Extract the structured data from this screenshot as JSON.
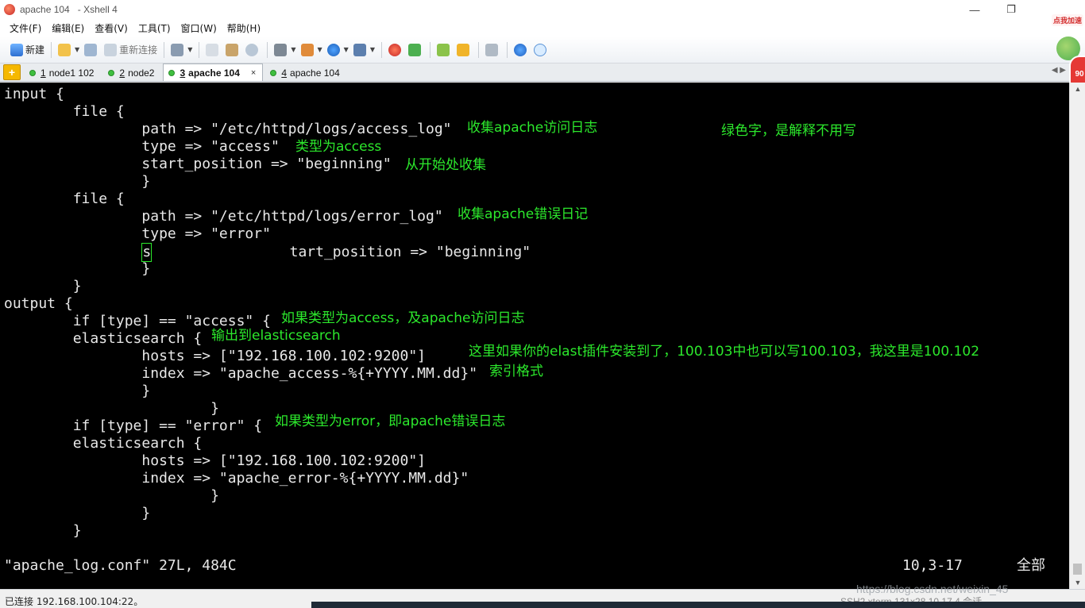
{
  "window": {
    "title": "apache 104",
    "app": "- Xshell 4"
  },
  "window_controls": {
    "minimize": "—",
    "restore": "❐",
    "close": "✕"
  },
  "menu": [
    "文件(F)",
    "编辑(E)",
    "查看(V)",
    "工具(T)",
    "窗口(W)",
    "帮助(H)"
  ],
  "toolbar": {
    "new_label": "新建",
    "reconnect_label": "重新连接"
  },
  "promo": {
    "label": "点我加速",
    "badge": "90"
  },
  "tabs": [
    {
      "num": "1",
      "label": "node1 102"
    },
    {
      "num": "2",
      "label": "node2"
    },
    {
      "num": "3",
      "label": "apache 104"
    },
    {
      "num": "4",
      "label": "apache 104"
    }
  ],
  "tab_close": "×",
  "tab_scroll": "◀ ▶",
  "terminal": {
    "lines": [
      "input {",
      "        file {",
      "                path => \"/etc/httpd/logs/access_log\"",
      "                type => \"access\"",
      "                start_position => \"beginning\"",
      "                }",
      "        file {",
      "                path => \"/etc/httpd/logs/error_log\"",
      "                type => \"error\"",
      "                tart_position => \"beginning\"",
      "                }",
      "        }",
      "output {",
      "        if [type] == \"access\" {",
      "        elasticsearch {",
      "                hosts => [\"192.168.100.102:9200\"]",
      "                index => \"apache_access-%{+YYYY.MM.dd}\"",
      "                }",
      "                        }",
      "        if [type] == \"error\" {",
      "        elasticsearch {",
      "                hosts => [\"192.168.100.102:9200\"]",
      "                index => \"apache_error-%{+YYYY.MM.dd}\"",
      "                        }",
      "                }",
      "        }"
    ],
    "cursor_char": "s",
    "status_file": "\"apache_log.conf\" 27L, 484C",
    "status_pos": "10,3-17",
    "status_all": "全部"
  },
  "annotations": {
    "access_path": "收集apache访问日志",
    "green_note": "绿色字，是解释不用写",
    "access_type": "类型为access",
    "start_pos": "从开始处收集",
    "error_path": "收集apache错误日记",
    "if_access": "如果类型为access，及apache访问日志",
    "output_es": "输出到elasticsearch",
    "hosts_note": "这里如果你的elast插件安装到了，100.103中也可以写100.103，我这里是100.102",
    "index_note": "索引格式",
    "if_error": "如果类型为error，即apache错误日志"
  },
  "statusbar": {
    "connection": "已连接 192.168.100.104:22。",
    "right": "SSH2  xterm  131x28  10,17  4 会话"
  },
  "watermark": "https://blog.csdn.net/weixin_45",
  "colors": {
    "terminal_bg": "#000000",
    "terminal_fg": "#e8e8e8",
    "note": "#2ce82c"
  }
}
